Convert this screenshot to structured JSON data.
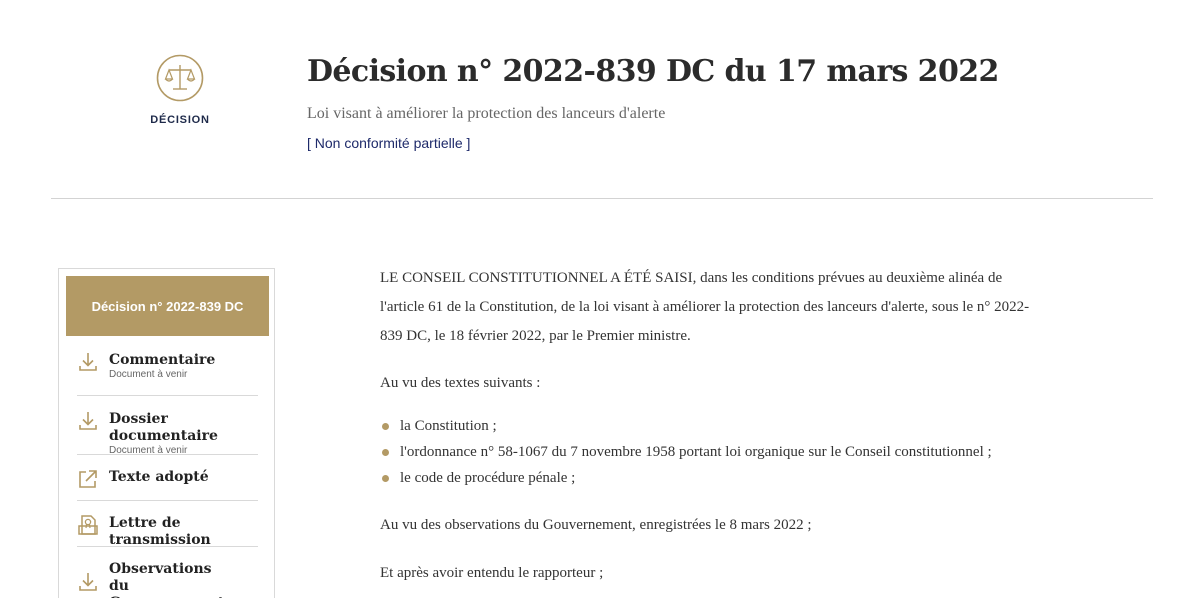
{
  "header": {
    "logo_label": "DÉCISION",
    "title": "Décision n° 2022-839 DC du 17 mars 2022",
    "subtitle": "Loi visant à améliorer la protection des lanceurs d'alerte",
    "status": "[ Non conformité partielle ]"
  },
  "colors": {
    "accent_gold": "#b39a65",
    "navy": "#1e2a6a",
    "text": "#333333"
  },
  "sidebar": {
    "active_label": "Décision n° 2022-839 DC",
    "items": [
      {
        "label": "Commentaire",
        "sublabel": "Document à venir",
        "icon": "download-icon"
      },
      {
        "label": "Dossier documentaire",
        "sublabel": "Document à venir",
        "icon": "download-icon"
      },
      {
        "label": "Texte adopté",
        "sublabel": "",
        "icon": "external-link-icon"
      },
      {
        "label": "Lettre de transmission",
        "sublabel": "",
        "icon": "document-seal-icon"
      },
      {
        "label": "Observations du Gouvernement",
        "sublabel": "",
        "icon": "download-icon"
      }
    ]
  },
  "main": {
    "intro": "LE CONSEIL CONSTITUTIONNEL A ÉTÉ SAISI, dans les conditions prévues au deuxième alinéa de l'article 61 de la Constitution, de la loi visant à améliorer la protection des lanceurs d'alerte, sous le n° 2022-839 DC, le 18 février 2022, par le Premier ministre.",
    "seen_texts": "Au vu des textes suivants :",
    "legal_texts": [
      "la Constitution ;",
      "l'ordonnance n° 58-1067 du 7 novembre 1958 portant loi organique sur le Conseil constitutionnel ;",
      "le code de procédure pénale ;"
    ],
    "observations": "Au vu des observations du Gouvernement, enregistrées le 8 mars 2022 ;",
    "rapporteur": "Et après avoir entendu le rapporteur ;"
  }
}
